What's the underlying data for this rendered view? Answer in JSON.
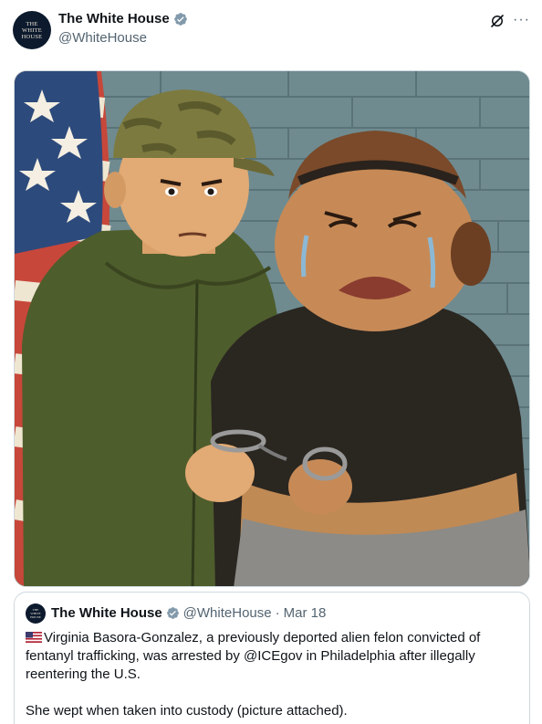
{
  "post": {
    "author_name": "The White House",
    "author_handle": "@WhiteHouse",
    "avatar_text": "THE\nWHITE\nHOUSE"
  },
  "media": {
    "alt": "Illustration of an agent in a camouflage cap and green jacket holding a crying handcuffed woman in front of a brick wall and an American flag"
  },
  "quoted_post": {
    "author_name": "The White House",
    "author_handle": "@WhiteHouse",
    "date": "Mar 18",
    "separator": "·",
    "text_line": "Virginia Basora-Gonzalez, a previously deported alien felon convicted of fentanyl trafficking, was arrested by @ICEgov in Philadelphia after illegally reentering the U.S.",
    "text_second": "She wept when taken into custody (picture attached)."
  },
  "colors": {
    "verified_badge": "#829aab",
    "secondary_text": "#536471",
    "border": "#cfd9de"
  },
  "icons": [
    "verified-badge-icon",
    "grok-icon",
    "more-icon",
    "us-flag-icon"
  ]
}
